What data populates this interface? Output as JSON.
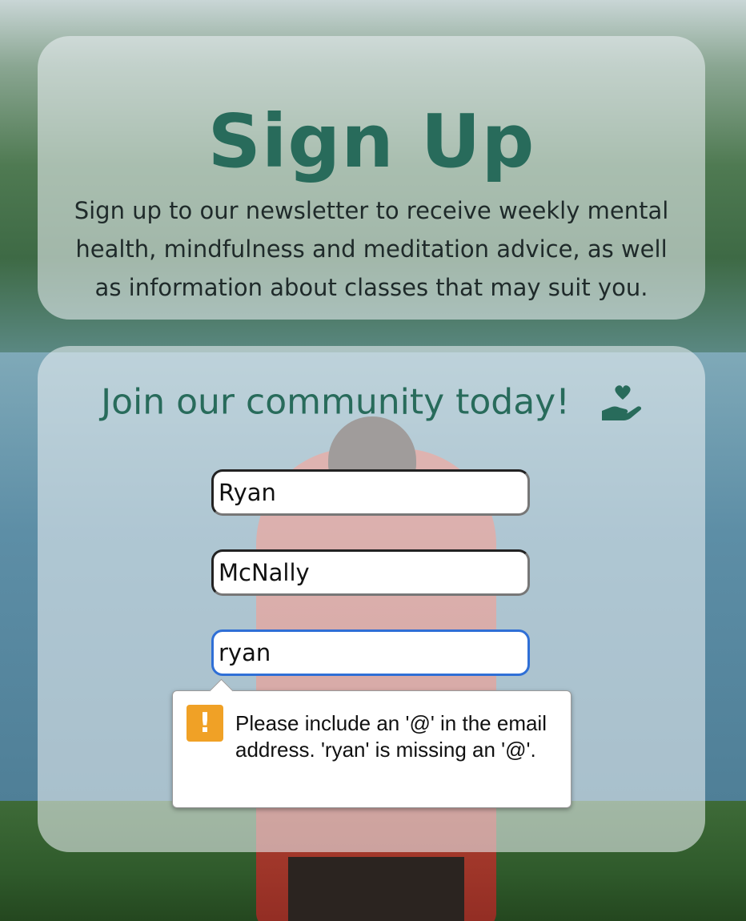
{
  "intro": {
    "title": "Sign Up",
    "text": "Sign up to our newsletter to receive weekly mental health, mindfulness and meditation advice, as well as information about classes that may suit you."
  },
  "form": {
    "heading": "Join our community today!",
    "heading_icon": "hand-holding-heart-icon",
    "first_name_value": "Ryan",
    "last_name_value": "McNally",
    "email_value": "ryan"
  },
  "validation": {
    "icon": "warning-icon",
    "icon_glyph": "!",
    "message": "Please include an '@' in the email address. 'ryan' is missing an '@'."
  },
  "colors": {
    "accent": "#286b5b",
    "focus_border": "#2f6fd6",
    "warning": "#f0a126"
  }
}
